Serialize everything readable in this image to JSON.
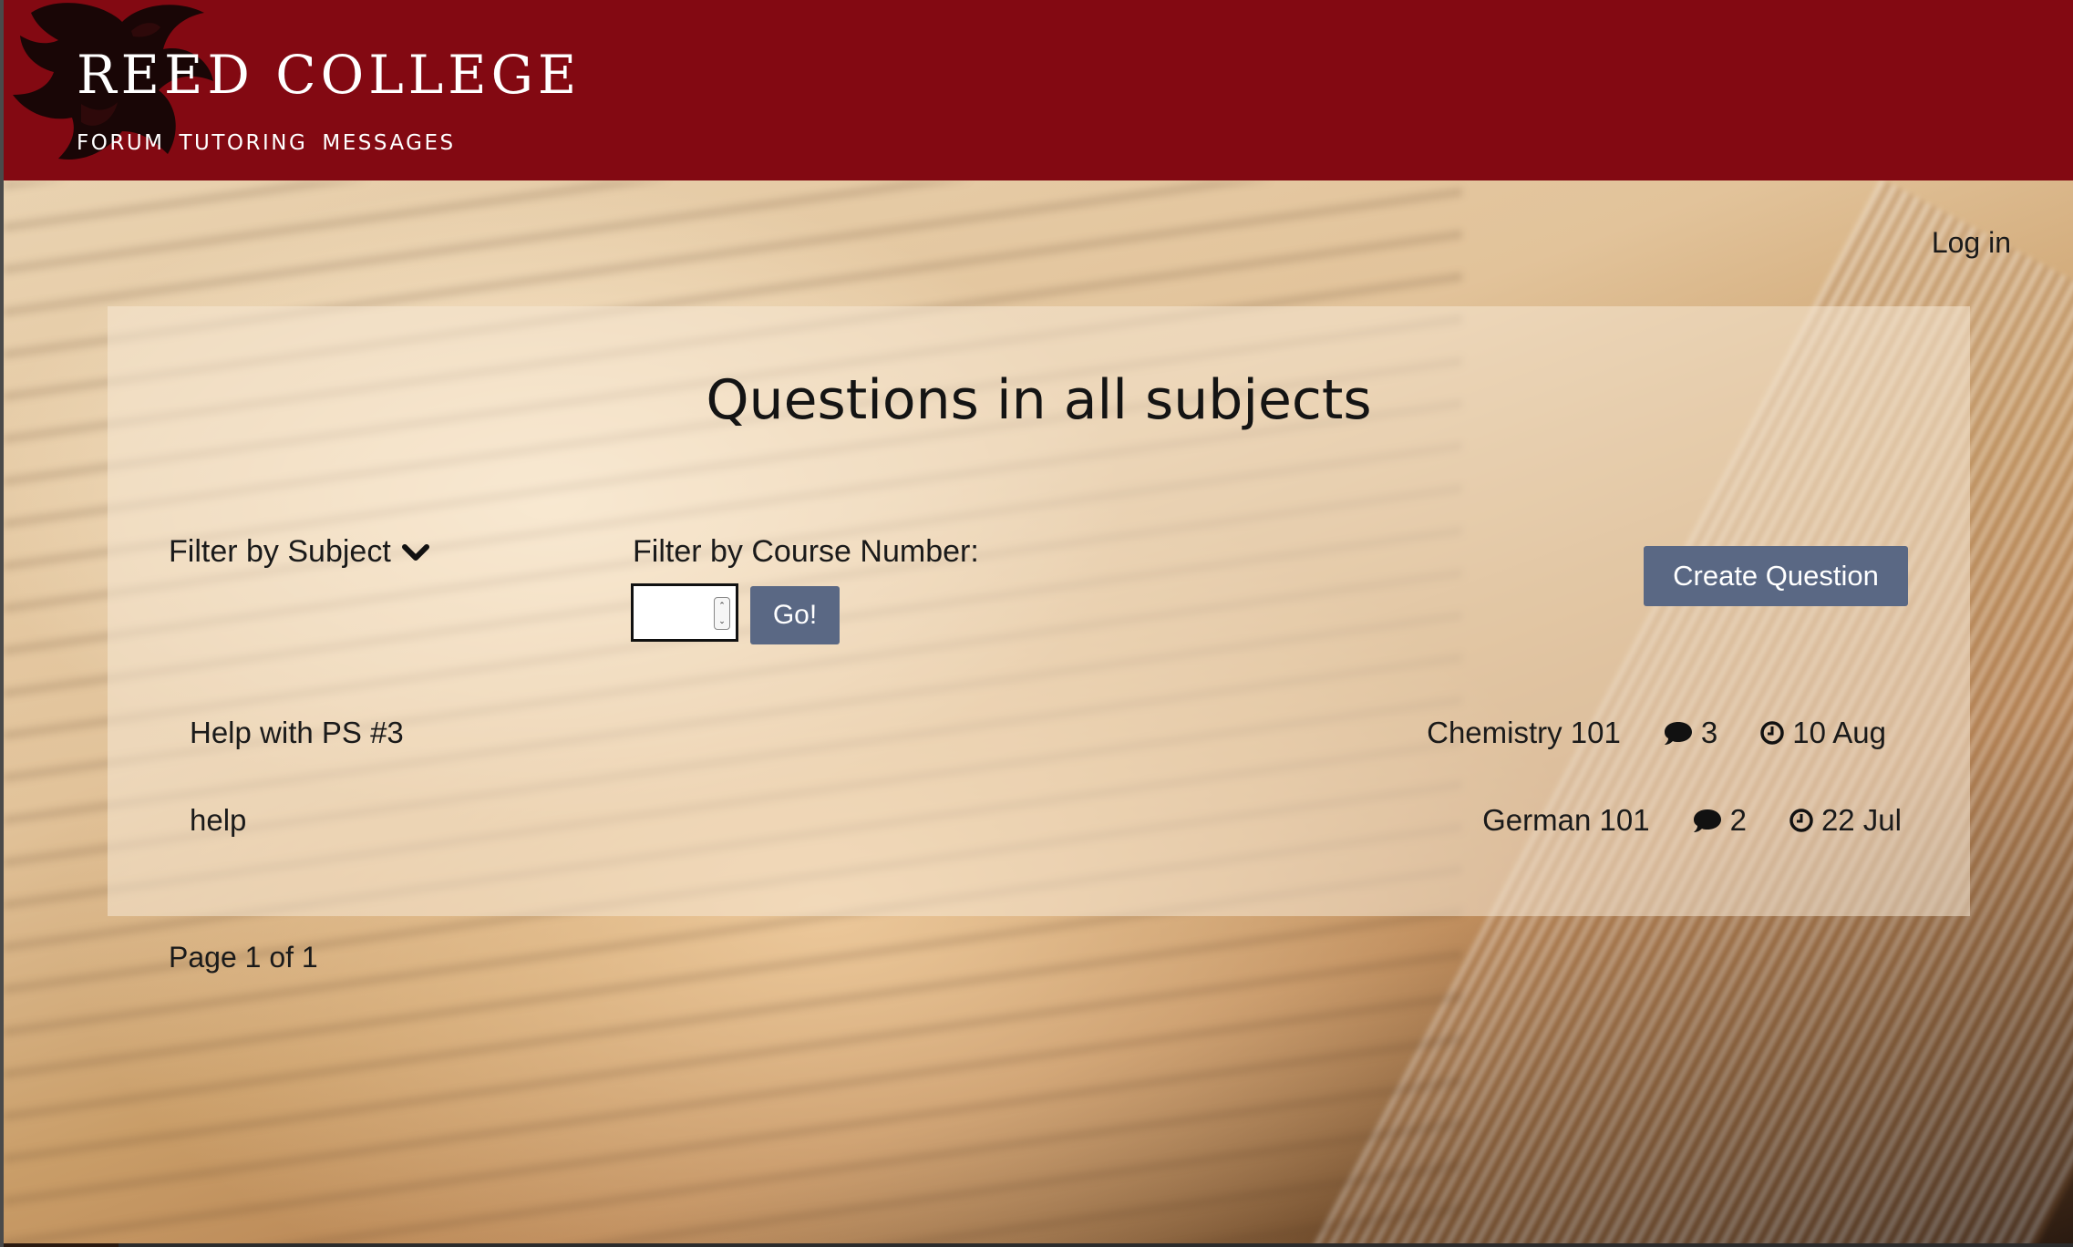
{
  "header": {
    "title": "REED COLLEGE",
    "nav": [
      "FORUM",
      "TUTORING",
      "MESSAGES"
    ],
    "logo_icon": "griffin-logo-icon",
    "brand_color": "#830912"
  },
  "auth": {
    "login_label": "Log in"
  },
  "main": {
    "title": "Questions in all subjects",
    "filter_subject_label": "Filter by Subject",
    "filter_course_label": "Filter by Course Number:",
    "course_input_value": "",
    "go_label": "Go!",
    "create_label": "Create Question",
    "button_color": "#5a6884"
  },
  "questions": [
    {
      "title": "Help with PS #3",
      "subject": "Chemistry 101",
      "replies": "3",
      "date": "10 Aug"
    },
    {
      "title": "help",
      "subject": "German 101",
      "replies": "2",
      "date": "22 Jul"
    }
  ],
  "pagination": {
    "label": "Page 1 of 1"
  }
}
